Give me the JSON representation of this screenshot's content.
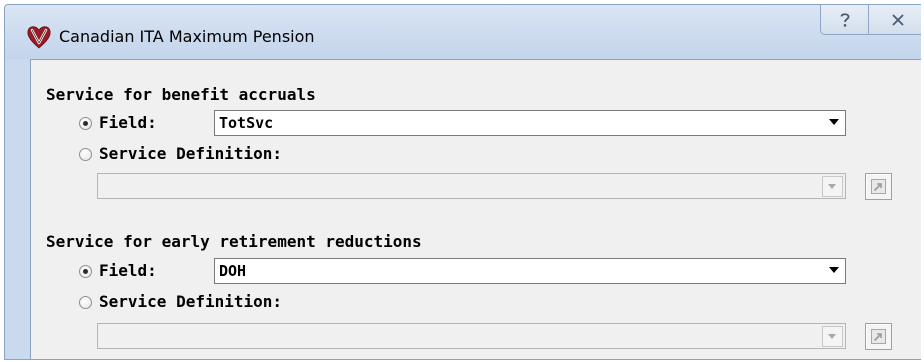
{
  "window": {
    "title": "Canadian ITA Maximum Pension",
    "icons": {
      "app": "heart-v-icon",
      "help": "help-icon",
      "close": "close-icon"
    }
  },
  "benefit_accruals": {
    "title": "Service for benefit accruals",
    "field_option": {
      "label": "Field:",
      "selected": true
    },
    "field_value": "TotSvc",
    "service_definition_option": {
      "label": "Service Definition:",
      "selected": false
    },
    "service_definition_value": "",
    "browse_button_icon": "edit-link-icon"
  },
  "early_retirement": {
    "title": "Service for early retirement reductions",
    "field_option": {
      "label": "Field:",
      "selected": true
    },
    "field_value": "DOH",
    "service_definition_option": {
      "label": "Service Definition:",
      "selected": false
    },
    "service_definition_value": "",
    "browse_button_icon": "edit-link-icon"
  }
}
